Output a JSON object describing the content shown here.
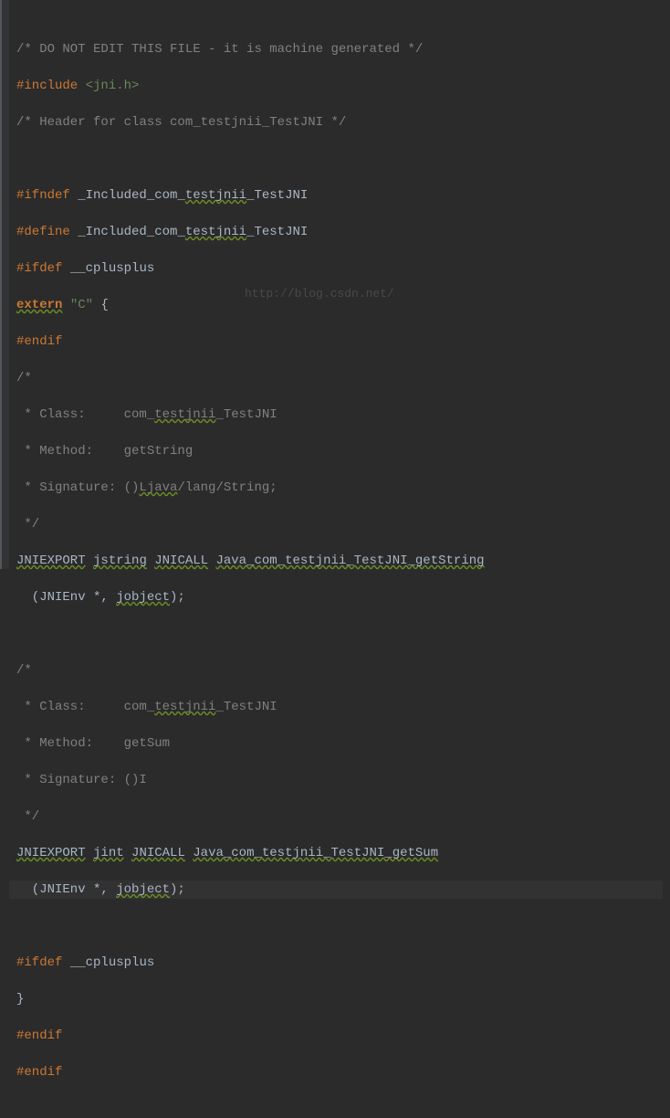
{
  "watermark": "http://blog.csdn.net/",
  "code": {
    "l1_a": "/* DO NOT EDIT THIS FILE - it is machine generated */",
    "l2_a": "#include",
    "l2_b": "<jni.h>",
    "l3_a": "/* Header for class com_testjnii_TestJNI */",
    "l5_a": "#ifndef",
    "l5_b": "_Included_com_",
    "l5_c": "testjnii",
    "l5_d": "_TestJNI",
    "l6_a": "#define",
    "l6_b": "_Included_com_",
    "l6_c": "testjnii",
    "l6_d": "_TestJNI",
    "l7_a": "#ifdef",
    "l7_b": "__cplusplus",
    "l8_a": "extern",
    "l8_b": "\"C\"",
    "l8_c": " {",
    "l9_a": "#endif",
    "l10_a": "/*",
    "l11_a": " * Class:     com_",
    "l11_b": "testjnii",
    "l11_c": "_TestJNI",
    "l12_a": " * Method:    getString",
    "l13_a": " * Signature: ()",
    "l13_b": "Ljava",
    "l13_c": "/lang/String;",
    "l14_a": " */",
    "l15_a": "JNIEXPORT",
    "l15_b": "jstring",
    "l15_c": "JNICALL",
    "l15_d": "Java_com_testjnii_TestJNI_getString",
    "l16_a": "  (JNIEnv *, ",
    "l16_b": "jobject",
    "l16_c": ");",
    "l18_a": "/*",
    "l19_a": " * Class:     com_",
    "l19_b": "testjnii",
    "l19_c": "_TestJNI",
    "l20_a": " * Method:    getSum",
    "l21_a": " * Signature: ()I",
    "l22_a": " */",
    "l23_a": "JNIEXPORT",
    "l23_b": "jint",
    "l23_c": "JNICALL",
    "l23_d": "Java_com_testjnii_TestJNI_getSum",
    "l24_a": "  (JNIEnv *, ",
    "l24_b": "jobject",
    "l24_c": ");",
    "l26_a": "#ifdef",
    "l26_b": "__cplusplus",
    "l27_a": "}",
    "l28_a": "#endif",
    "l29_a": "#endif"
  }
}
